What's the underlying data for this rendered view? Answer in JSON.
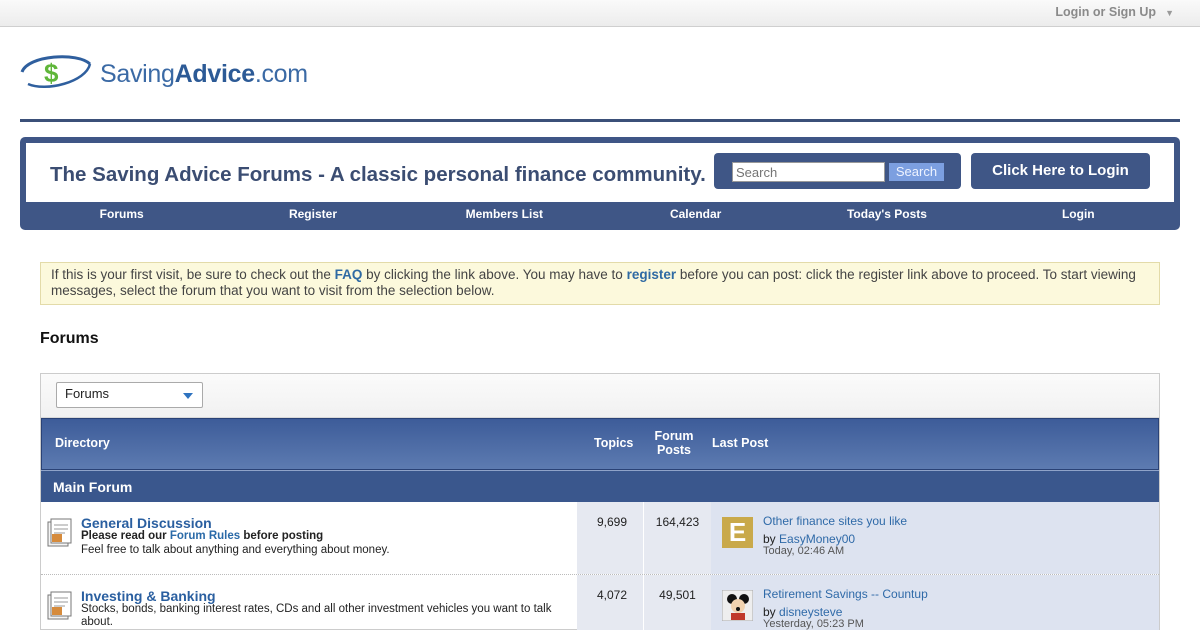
{
  "topbar": {
    "login_signup": "Login or Sign Up",
    "caret": "▼"
  },
  "logo": {
    "text_regular": "Saving",
    "text_bold": "Advice",
    "text_suffix": ".com",
    "icon": "dollar-swoosh-icon",
    "brand_color": "#3b6aa5"
  },
  "header": {
    "title": "The Saving Advice Forums - A classic personal finance community.",
    "search_placeholder": "Search",
    "search_button": "Search",
    "login_button": "Click Here to Login"
  },
  "nav": {
    "items": [
      "Forums",
      "Register",
      "Members List",
      "Calendar",
      "Today's Posts",
      "Login"
    ]
  },
  "notice": {
    "part1": "If this is your first visit, be sure to check out the ",
    "faq": "FAQ",
    "part2": " by clicking the link above. You may have to ",
    "register": "register",
    "part3": " before you can post: click the register link above to proceed. To start viewing messages, select the forum that you want to visit from the selection below."
  },
  "forums_heading": "Forums",
  "forum_select": {
    "selected": "Forums"
  },
  "columns": {
    "directory": "Directory",
    "topics": "Topics",
    "forum_posts": "Forum Posts",
    "last_post": "Last Post"
  },
  "category": "Main Forum",
  "forums": [
    {
      "title": "General Discussion",
      "desc_pre": "Please read our ",
      "desc_link": "Forum Rules",
      "desc_post": " before posting",
      "desc2": "Feel free to talk about anything and everything about money.",
      "topics": "9,699",
      "posts": "164,423",
      "last_title": "Other finance sites you like",
      "by": "by ",
      "last_user": "EasyMoney00",
      "last_time": "Today, 02:46 AM",
      "avatar_letter": "E"
    },
    {
      "title": "Investing & Banking",
      "desc": "Stocks, bonds, banking interest rates, CDs and all other investment vehicles you want to talk about.",
      "topics": "4,072",
      "posts": "49,501",
      "last_title": "Retirement Savings -- Countup",
      "by": "by ",
      "last_user": "disneysteve",
      "last_time": "Yesterday, 05:23 PM"
    }
  ]
}
